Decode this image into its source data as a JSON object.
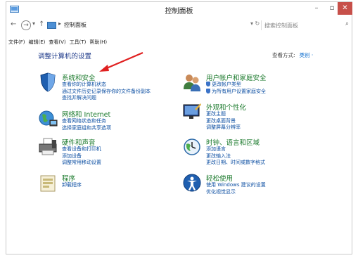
{
  "window": {
    "title": "控制面板",
    "controls": {
      "minimize": "–",
      "maximize": "▫",
      "close": "✕"
    }
  },
  "address": {
    "path": "控制面板",
    "separator": "▸",
    "tools": "▾ ↻",
    "search_placeholder": "搜索控制面板"
  },
  "menu": [
    "文件(F)",
    "编辑(E)",
    "查看(V)",
    "工具(T)",
    "帮助(H)"
  ],
  "main": {
    "heading": "调整计算机的设置",
    "view_by_label": "查看方式:",
    "view_by_value": "类别 ·"
  },
  "categories": [
    {
      "name": "系统和安全",
      "links": [
        "查看你的计算机状态",
        "通过文件历史记录保存你的文件备份副本",
        "查找并解决问题"
      ]
    },
    {
      "name": "网络和 Internet",
      "links": [
        "查看网络状态和任务",
        "选择家庭组和共享选项"
      ]
    },
    {
      "name": "硬件和声音",
      "links": [
        "查看设备和打印机",
        "添加设备",
        "调整常用移动设置"
      ]
    },
    {
      "name": "程序",
      "links": [
        "卸载程序"
      ]
    },
    {
      "name": "用户帐户和家庭安全",
      "links": [
        "更改帐户类型",
        "为所有用户设置家庭安全"
      ]
    },
    {
      "name": "外观和个性化",
      "links": [
        "更改主题",
        "更改桌面背景",
        "调整屏幕分辨率"
      ]
    },
    {
      "name": "时钟、语言和区域",
      "links": [
        "添加语言",
        "更改输入法",
        "更改日期、时间或数字格式"
      ]
    },
    {
      "name": "轻松使用",
      "links": [
        "使用 Windows 建议的设置",
        "优化视觉显示"
      ]
    }
  ],
  "colors": {
    "heading": "#1e3a8a",
    "category_title": "#1b7a2c",
    "link": "#0b4ea2",
    "annotation_arrow": "#e02020",
    "close_button": "#c7504a"
  }
}
